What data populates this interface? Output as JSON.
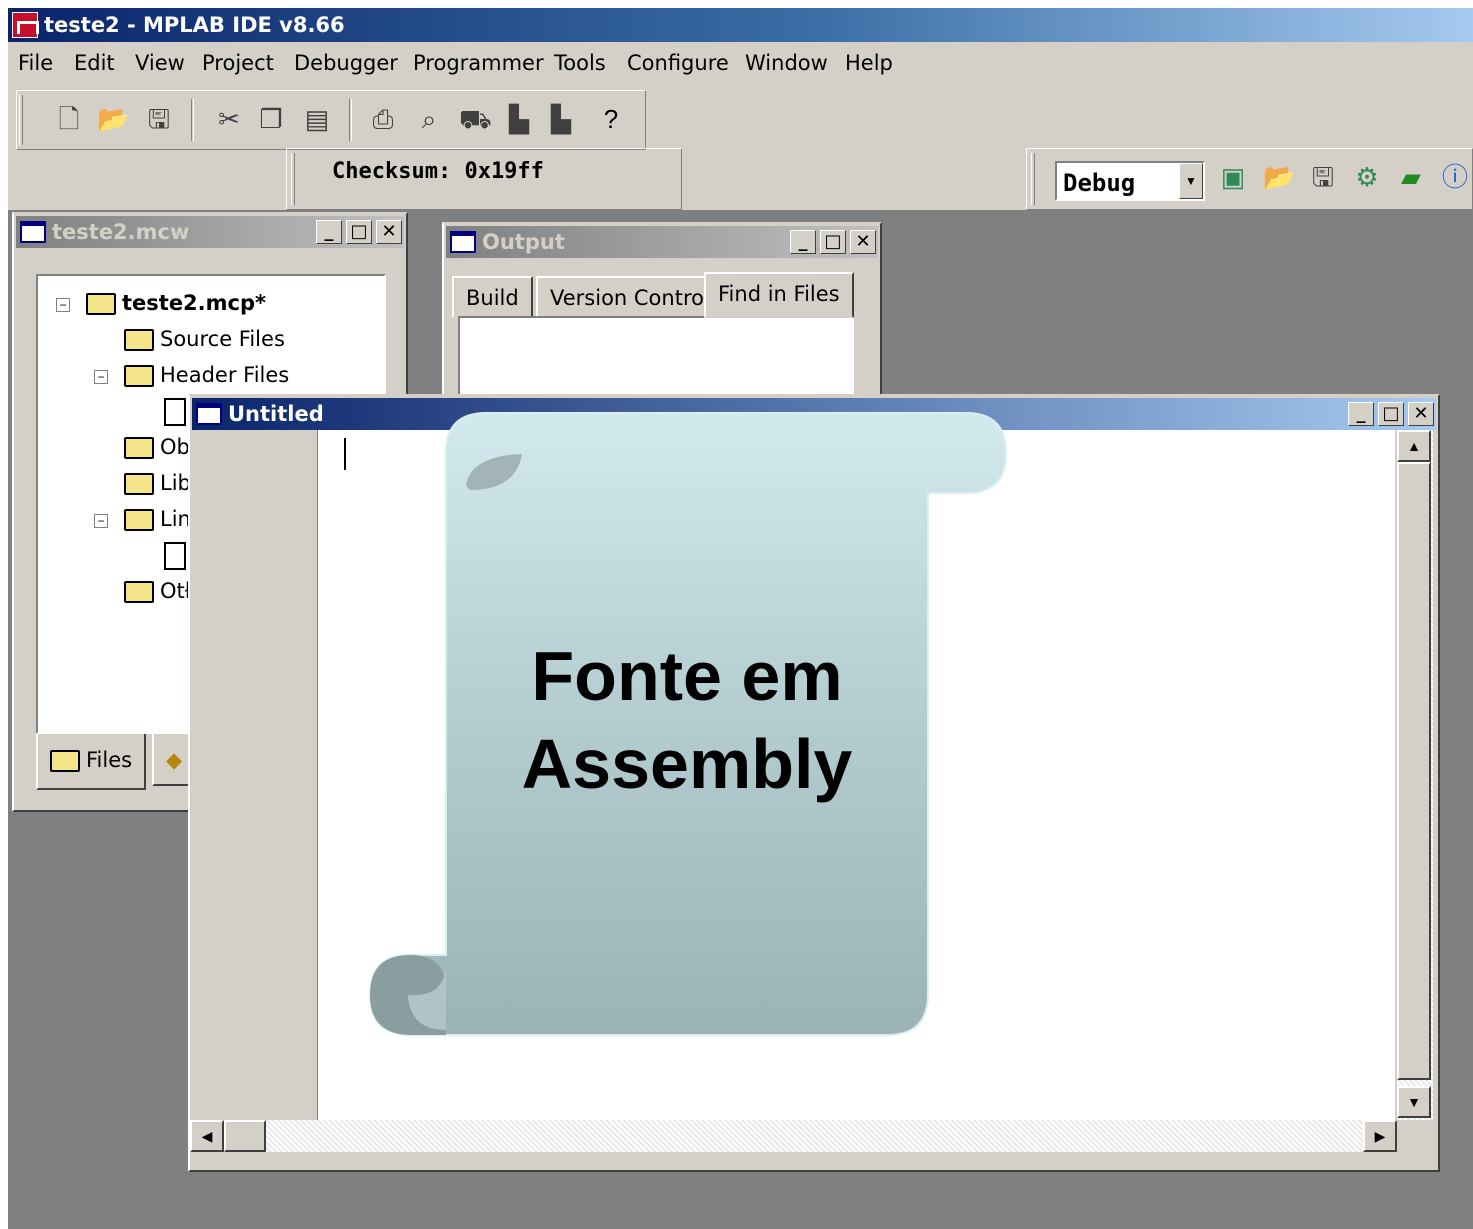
{
  "app": {
    "title": "teste2 - MPLAB IDE v8.66"
  },
  "menu": [
    "File",
    "Edit",
    "View",
    "Project",
    "Debugger",
    "Programmer",
    "Tools",
    "Configure",
    "Window",
    "Help"
  ],
  "toolbar": {
    "checksum": "Checksum:  0x19ff",
    "config": "Debug"
  },
  "workspace": {
    "title": "teste2.mcw",
    "project": "teste2.mcp*",
    "nodes": [
      "Source Files",
      "Header Files",
      "Ob",
      "Libı",
      "Linl",
      "Otł"
    ],
    "tab_files": "Files"
  },
  "output": {
    "title": "Output",
    "tabs": [
      "Build",
      "Version Control",
      "Find in Files"
    ]
  },
  "editor": {
    "title": "Untitled"
  },
  "callout": {
    "line1": "Fonte em",
    "line2": "Assembly"
  },
  "colors": {
    "title_active": "#0a246a",
    "face": "#d4d0c8",
    "mdi_bg": "#808080",
    "scroll_top": "#cfe6ea",
    "scroll_bottom": "#8fa5a7"
  }
}
